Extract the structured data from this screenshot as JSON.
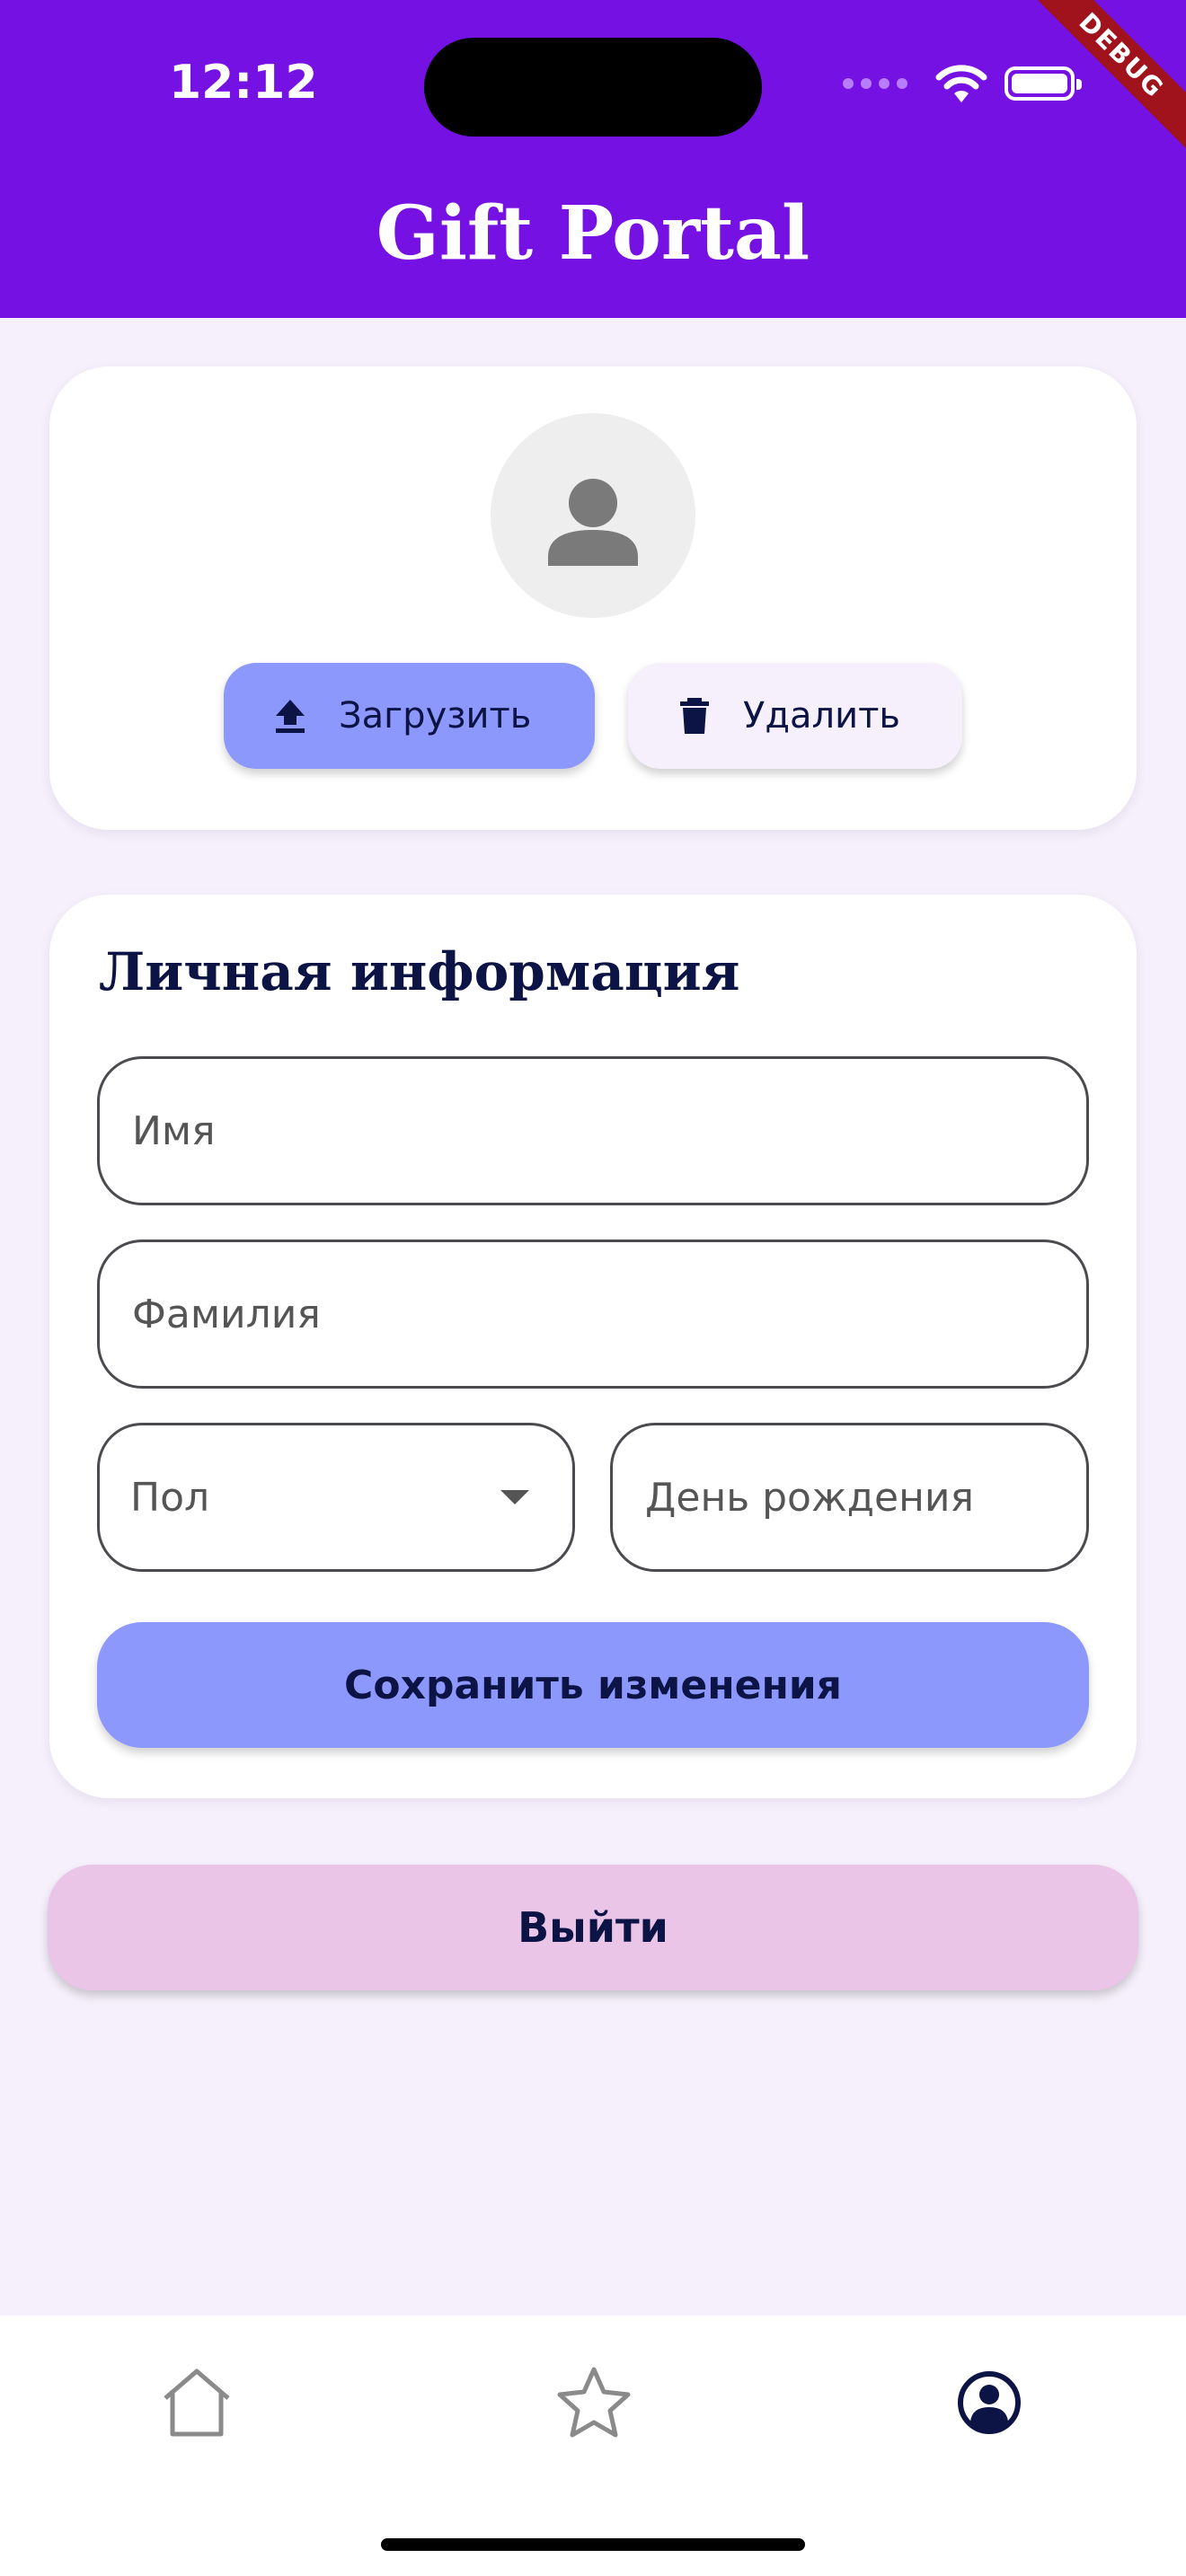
{
  "status_bar": {
    "time": "12:12",
    "debug_banner": "DEBUG"
  },
  "app_bar": {
    "title": "Gift Portal"
  },
  "avatar_section": {
    "upload_label": "Загрузить",
    "delete_label": "Удалить"
  },
  "personal_info": {
    "title": "Личная информация",
    "first_name": {
      "value": "",
      "placeholder": "Имя"
    },
    "last_name": {
      "value": "",
      "placeholder": "Фамилия"
    },
    "gender": {
      "label": "Пол"
    },
    "birthday": {
      "value": "",
      "placeholder": "День рождения"
    },
    "save_label": "Сохранить изменения"
  },
  "logout_label": "Выйти",
  "bottom_nav": {
    "items": [
      {
        "icon": "home-icon",
        "active": false
      },
      {
        "icon": "star-icon",
        "active": false
      },
      {
        "icon": "account-circle-icon",
        "active": true
      }
    ]
  },
  "colors": {
    "app_bar": "#7611e4",
    "background": "#f5f0fb",
    "primary_button": "#8d98fd",
    "logout_button": "#eac5e7",
    "text_dark": "#0c1445"
  }
}
